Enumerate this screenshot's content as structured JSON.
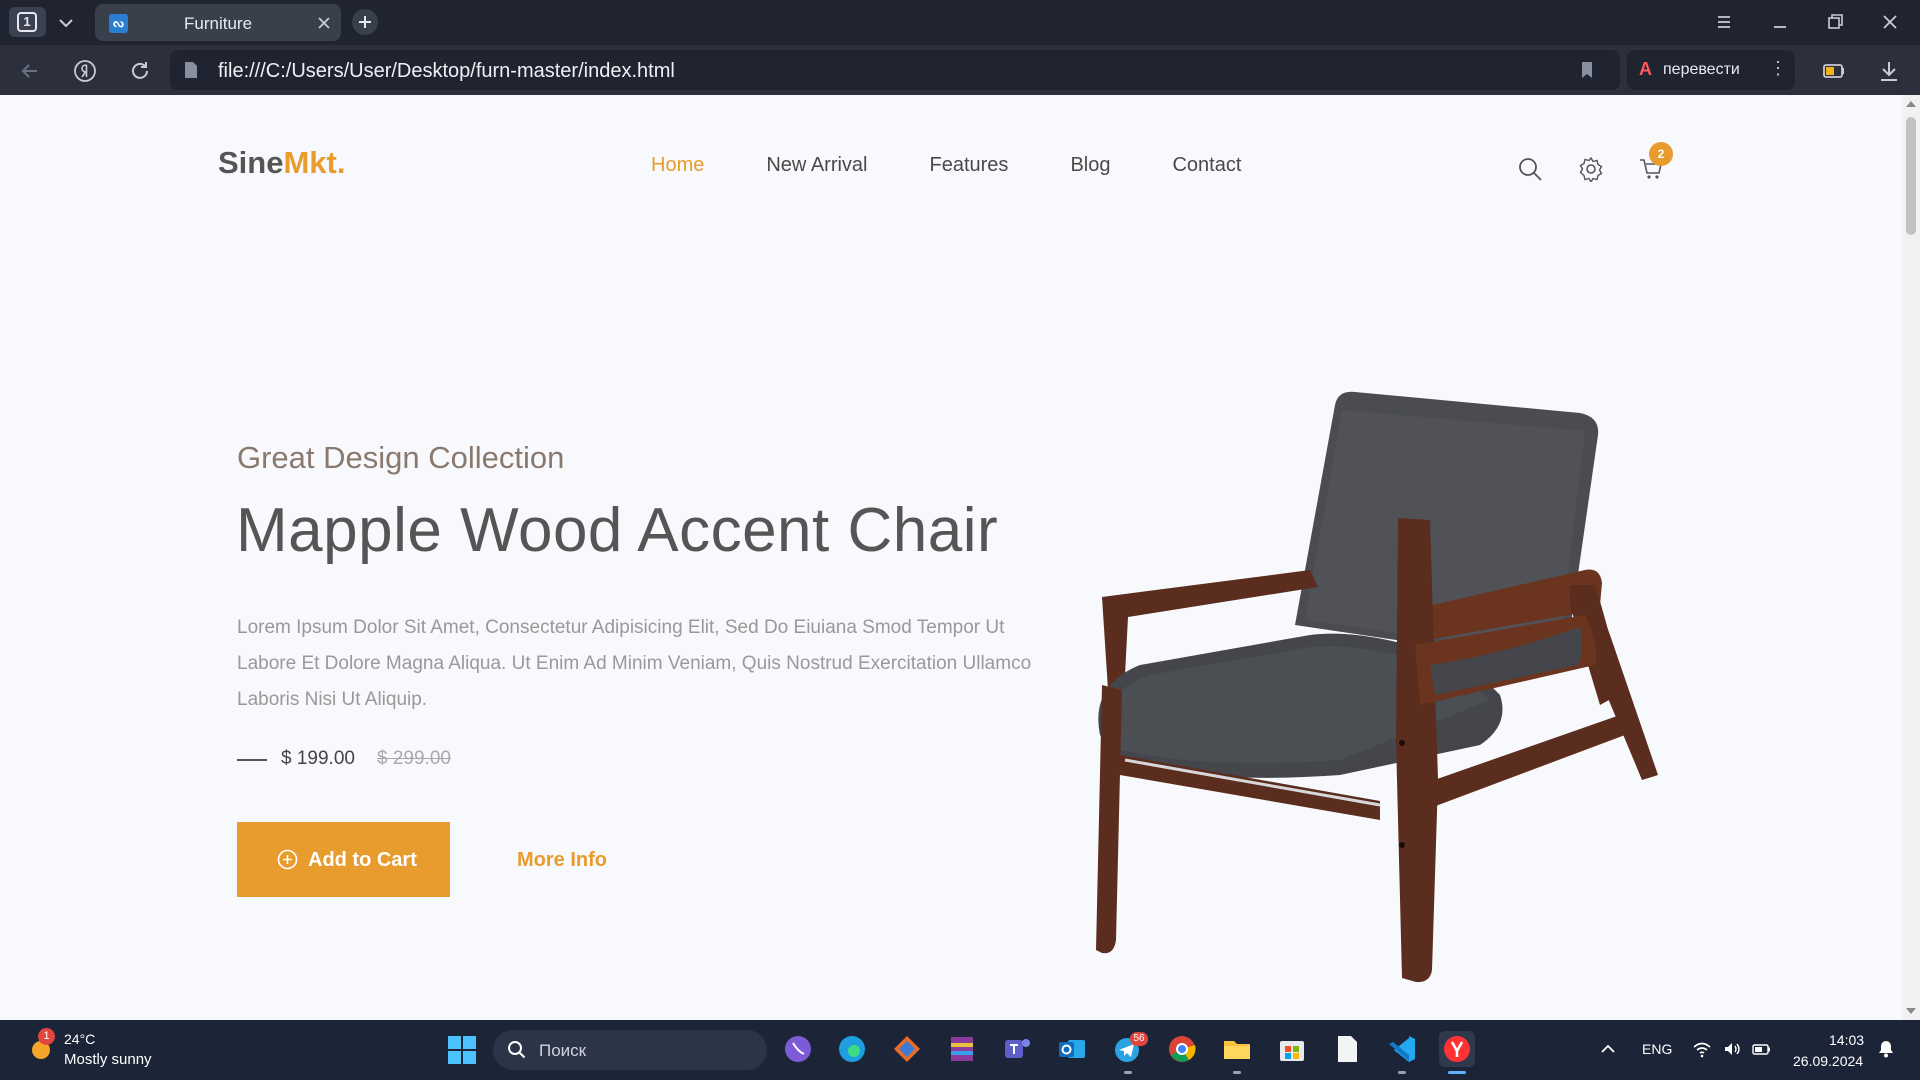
{
  "browser": {
    "tab_count": "1",
    "tab_title": "Furniture",
    "url": "file:///C:/Users/User/Desktop/furn-master/index.html",
    "translate_label": "перевести"
  },
  "site": {
    "logo_main": "Sine",
    "logo_accent": "Mkt.",
    "nav": [
      "Home",
      "New Arrival",
      "Features",
      "Blog",
      "Contact"
    ],
    "active_nav": "Home",
    "cart_count": "2",
    "accent_color": "#e99c2e"
  },
  "hero": {
    "subtitle": "Great Design Collection",
    "title": "Mapple Wood Accent Chair",
    "description": "Lorem Ipsum Dolor Sit Amet, Consectetur Adipisicing Elit, Sed Do Eiuiana Smod Tempor Ut Labore Et Dolore Magna Aliqua. Ut Enim Ad Minim Veniam, Quis Nostrud Exercitation Ullamco Laboris Nisi Ut Aliquip.",
    "price": "$ 199.00",
    "old_price": "$ 299.00",
    "add_to_cart": "Add to Cart",
    "more_info": "More Info"
  },
  "taskbar": {
    "weather_alerts": "1",
    "temperature": "24°C",
    "weather": "Mostly sunny",
    "search_placeholder": "Поиск",
    "telegram_badge": "56",
    "language": "ENG",
    "time": "14:03",
    "date": "26.09.2024"
  }
}
